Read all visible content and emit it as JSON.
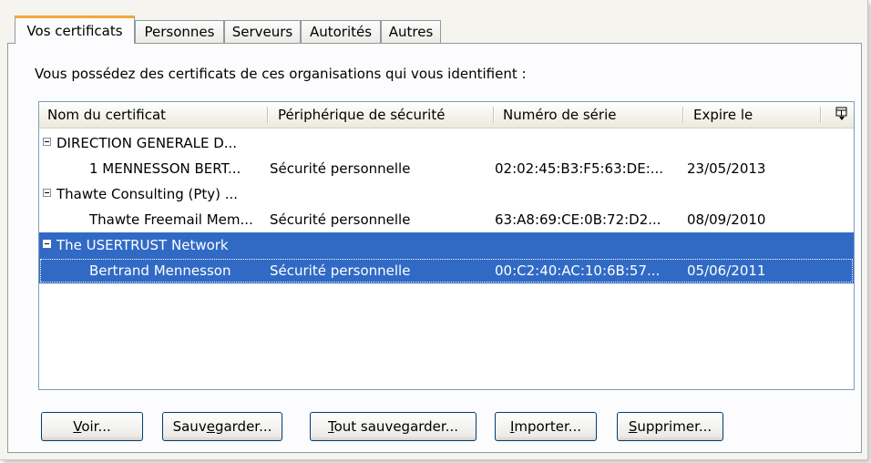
{
  "tabs": [
    {
      "label": "Vos certificats",
      "active": true
    },
    {
      "label": "Personnes"
    },
    {
      "label": "Serveurs"
    },
    {
      "label": "Autorités"
    },
    {
      "label": "Autres"
    }
  ],
  "intro_text": "Vous possédez des certificats de ces organisations qui vous identifient :",
  "columns": {
    "name": "Nom du certificat",
    "device": "Périphérique de sécurité",
    "serial": "Numéro de série",
    "expires": "Expire le"
  },
  "rows": [
    {
      "type": "group",
      "name": "DIRECTION GENERALE D..."
    },
    {
      "type": "cert",
      "name": "1 MENNESSON BERT...",
      "device": "Sécurité personnelle",
      "serial": "02:02:45:B3:F5:63:DE:...",
      "expires": "23/05/2013"
    },
    {
      "type": "group",
      "name": "Thawte Consulting (Pty) ..."
    },
    {
      "type": "cert",
      "name": "Thawte Freemail Mem...",
      "device": "Sécurité personnelle",
      "serial": "63:A8:69:CE:0B:72:D2...",
      "expires": "08/09/2010"
    },
    {
      "type": "group",
      "name": "The USERTRUST Network",
      "selected": true
    },
    {
      "type": "cert",
      "name": "Bertrand Mennesson",
      "device": "Sécurité personnelle",
      "serial": "00:C2:40:AC:10:6B:57...",
      "expires": "05/06/2011",
      "selected": true
    }
  ],
  "buttons": {
    "voir": {
      "mn": "V",
      "rest": "oir..."
    },
    "sauvegarder": {
      "pre": "Sauv",
      "mn": "e",
      "rest": "garder..."
    },
    "tout_sauvegarder": {
      "mn": "T",
      "rest": "out sauvegarder..."
    },
    "importer": {
      "mn": "I",
      "rest": "mporter..."
    },
    "supprimer": {
      "mn": "S",
      "rest": "upprimer..."
    }
  },
  "colors": {
    "selection": "#316ac5",
    "tab_highlight": "#f3a93a"
  },
  "icons": {
    "column_picker": "column-picker-icon",
    "collapse": "minus-box-icon"
  }
}
